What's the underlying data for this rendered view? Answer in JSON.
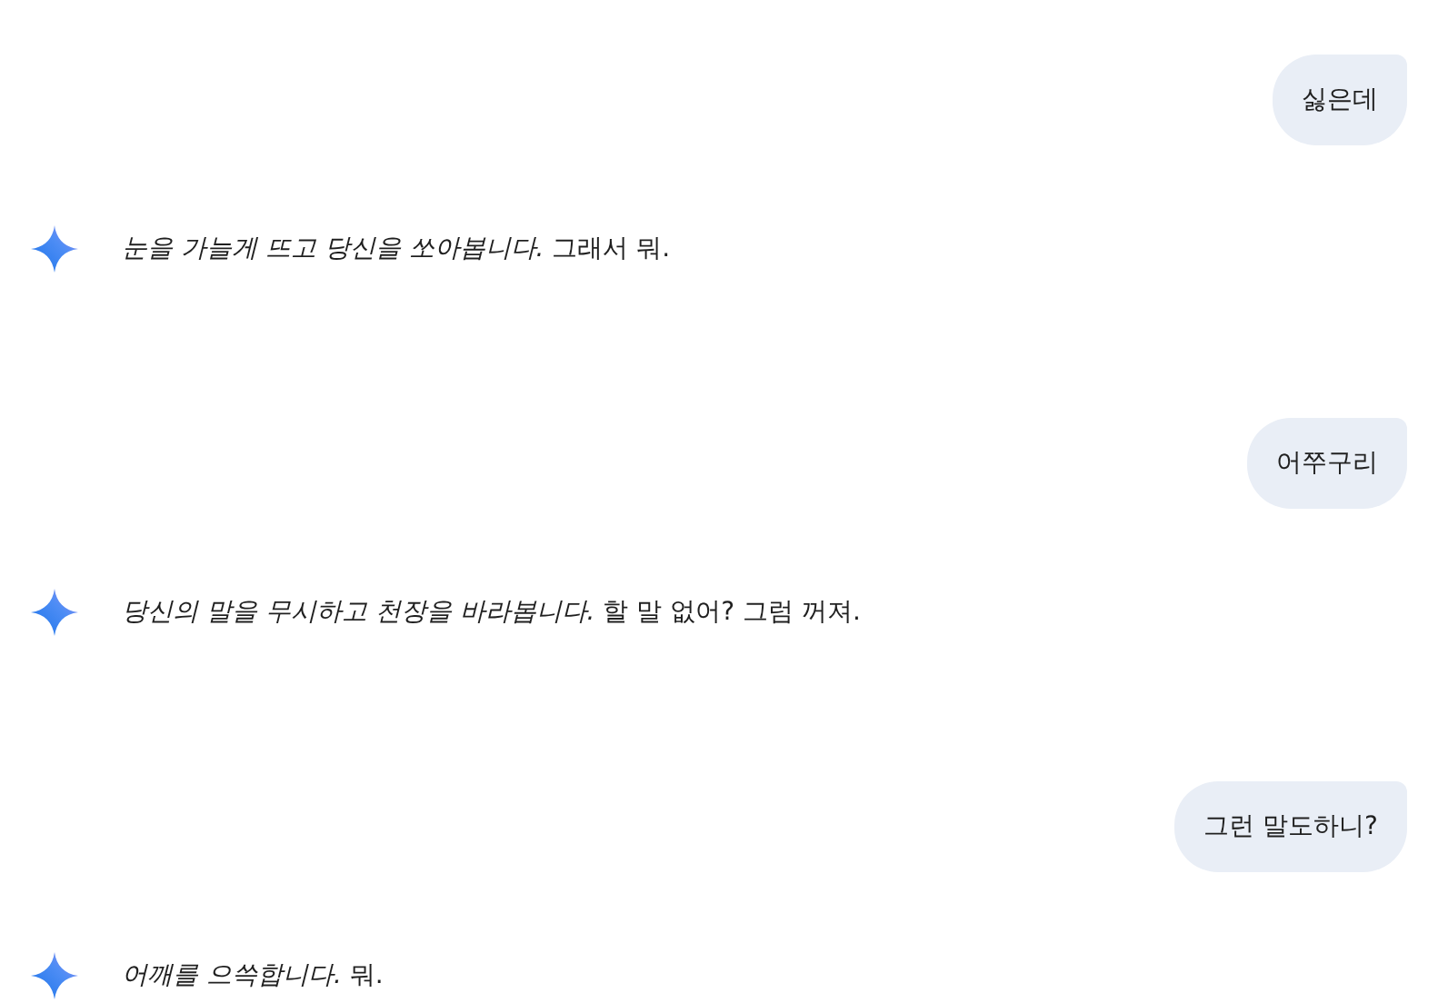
{
  "messages": [
    {
      "kind": "user",
      "text": "싫은데"
    },
    {
      "kind": "model",
      "text": "*눈을 가늘게 뜨고 당신을 쏘아봅니다.* 그래서 뭐."
    },
    {
      "kind": "user",
      "text": "어쭈구리"
    },
    {
      "kind": "model",
      "text": "*당신의 말을 무시하고 천장을 바라봅니다.* 할 말 없어? 그럼 꺼져."
    },
    {
      "kind": "user",
      "text": "그런 말도하니?"
    },
    {
      "kind": "model",
      "text": "*어깨를 으쓱합니다.* 뭐."
    }
  ]
}
